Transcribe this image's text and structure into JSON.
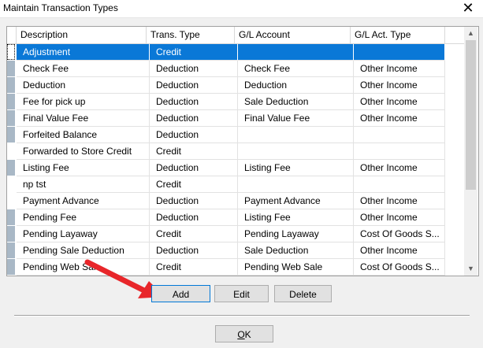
{
  "window": {
    "title": "Maintain Transaction Types",
    "close_glyph": "✕"
  },
  "grid": {
    "columns": [
      "Description",
      "Trans. Type",
      "G/L Account",
      "G/L Act. Type"
    ],
    "rows": [
      {
        "description": "Adjustment",
        "trans_type": "Credit",
        "gl_account": "",
        "gl_act_type": "",
        "selected": true,
        "indicator": "focus"
      },
      {
        "description": "Check Fee",
        "trans_type": "Deduction",
        "gl_account": "Check Fee",
        "gl_act_type": "Other Income",
        "indicator": "on"
      },
      {
        "description": "Deduction",
        "trans_type": "Deduction",
        "gl_account": "Deduction",
        "gl_act_type": "Other Income",
        "indicator": "on"
      },
      {
        "description": "Fee for pick up",
        "trans_type": "Deduction",
        "gl_account": "Sale Deduction",
        "gl_act_type": "Other Income",
        "indicator": "on"
      },
      {
        "description": "Final Value Fee",
        "trans_type": "Deduction",
        "gl_account": "Final Value Fee",
        "gl_act_type": "Other Income",
        "indicator": "on"
      },
      {
        "description": "Forfeited Balance",
        "trans_type": "Deduction",
        "gl_account": "",
        "gl_act_type": "",
        "indicator": "on"
      },
      {
        "description": "Forwarded to Store Credit",
        "trans_type": "Credit",
        "gl_account": "",
        "gl_act_type": "",
        "indicator": "off"
      },
      {
        "description": "Listing Fee",
        "trans_type": "Deduction",
        "gl_account": "Listing Fee",
        "gl_act_type": "Other Income",
        "indicator": "on"
      },
      {
        "description": "np tst",
        "trans_type": "Credit",
        "gl_account": "",
        "gl_act_type": "",
        "indicator": "off"
      },
      {
        "description": "Payment Advance",
        "trans_type": "Deduction",
        "gl_account": "Payment Advance",
        "gl_act_type": "Other Income",
        "indicator": "off"
      },
      {
        "description": "Pending Fee",
        "trans_type": "Deduction",
        "gl_account": "Listing Fee",
        "gl_act_type": "Other Income",
        "indicator": "on"
      },
      {
        "description": "Pending Layaway",
        "trans_type": "Credit",
        "gl_account": "Pending Layaway",
        "gl_act_type": "Cost Of Goods S...",
        "indicator": "on"
      },
      {
        "description": "Pending Sale Deduction",
        "trans_type": "Deduction",
        "gl_account": "Sale Deduction",
        "gl_act_type": "Other Income",
        "indicator": "on"
      },
      {
        "description": "Pending Web Sale",
        "trans_type": "Credit",
        "gl_account": "Pending Web Sale",
        "gl_act_type": "Cost Of Goods S...",
        "indicator": "on"
      }
    ]
  },
  "buttons": {
    "add": "Add",
    "edit": "Edit",
    "delete": "Delete",
    "ok_first": "O",
    "ok_rest": "K"
  },
  "annotation": {
    "arrow_color": "#e8262a",
    "selection_color": "#0a78d7"
  }
}
